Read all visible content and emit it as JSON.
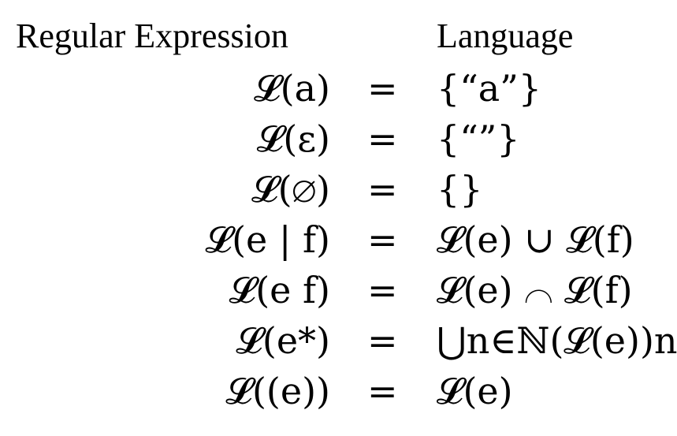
{
  "header": {
    "left": "Regular Expression",
    "right": "Language"
  },
  "rows": [
    {
      "lhs": "𝓛(a)",
      "eq": "=",
      "rhs": "{“a”}"
    },
    {
      "lhs": "𝓛(ε)",
      "eq": "=",
      "rhs": "{“”}"
    },
    {
      "lhs": "𝓛(∅)",
      "eq": "=",
      "rhs": "{}"
    },
    {
      "lhs": "𝓛(e | f)",
      "eq": "=",
      "rhs": "𝓛(e) ∪ 𝓛(f)"
    },
    {
      "lhs": "𝓛(e f)",
      "eq": "=",
      "rhs": "𝓛(e) ⌒ 𝓛(f)"
    },
    {
      "lhs": "𝓛(e*)",
      "eq": "=",
      "rhs": "⋃n∈ℕ(𝓛(e))n"
    },
    {
      "lhs": "𝓛((e))",
      "eq": "=",
      "rhs": "𝓛(e)"
    }
  ]
}
